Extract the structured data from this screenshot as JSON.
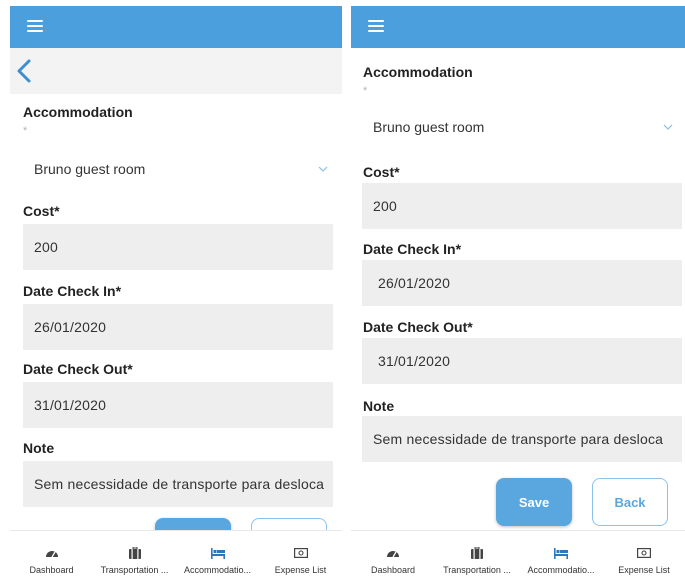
{
  "form": {
    "accommodation_label": "Accommodation",
    "accommodation_required": "*",
    "accommodation_value": "Bruno guest room",
    "cost_label": "Cost*",
    "cost_value": "200",
    "checkin_label": "Date Check In*",
    "checkin_value": "26/01/2020",
    "checkout_label": "Date Check Out*",
    "checkout_value": "31/01/2020",
    "note_label": "Note",
    "note_value": "Sem necessidade de transporte para desloca"
  },
  "buttons": {
    "save_label": "Save",
    "back_label": "Back"
  },
  "bottom_nav": [
    {
      "label": "Dashboard",
      "icon": "dashboard-gauge-icon"
    },
    {
      "label": "Transportation ...",
      "icon": "luggage-icon"
    },
    {
      "label": "Accommodatio...",
      "icon": "bed-icon"
    },
    {
      "label": "Expense List",
      "icon": "money-icon"
    }
  ],
  "colors": {
    "app_bar": "#4a9fdc",
    "accent": "#5aa7e0",
    "field_background": "#eeeeee"
  }
}
